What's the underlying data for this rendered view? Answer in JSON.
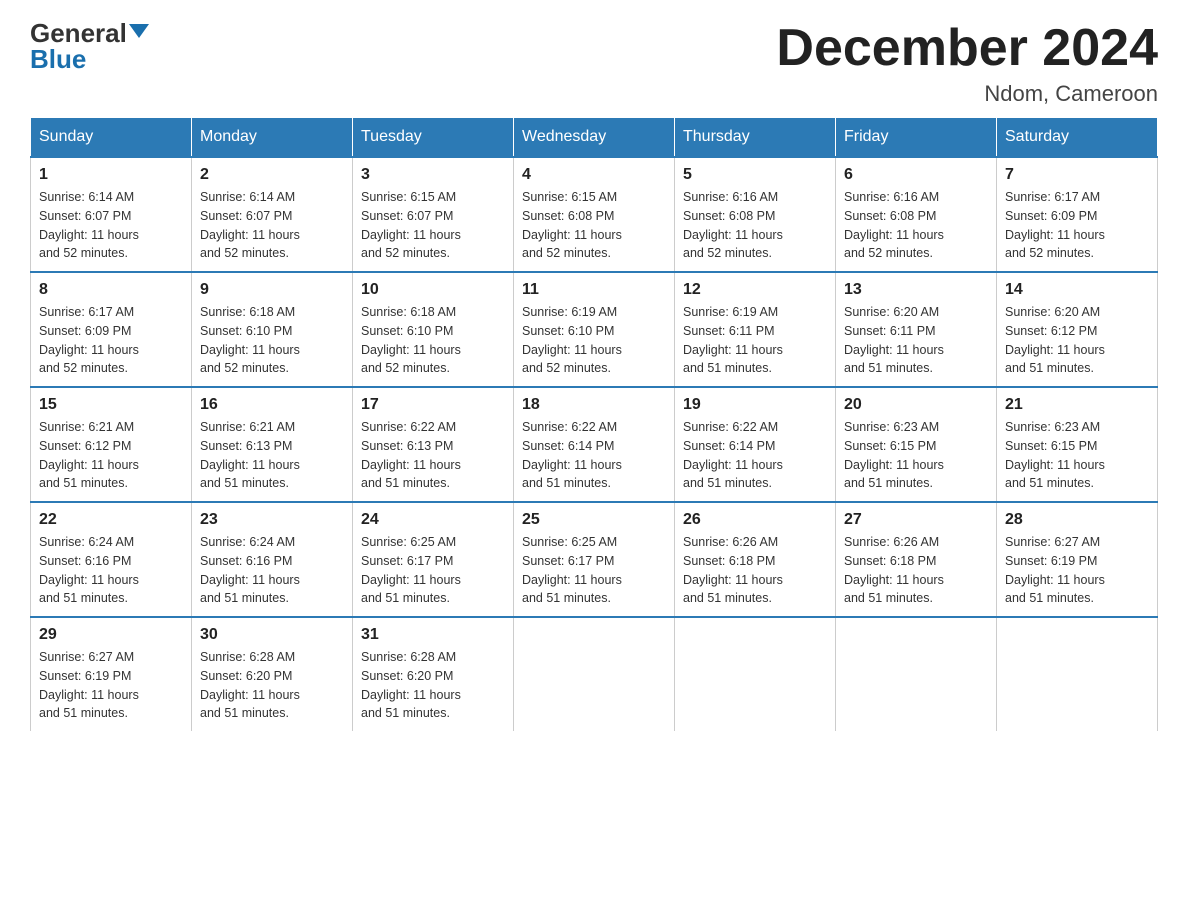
{
  "logo": {
    "general": "General",
    "blue": "Blue"
  },
  "title": "December 2024",
  "location": "Ndom, Cameroon",
  "weekdays": [
    "Sunday",
    "Monday",
    "Tuesday",
    "Wednesday",
    "Thursday",
    "Friday",
    "Saturday"
  ],
  "weeks": [
    [
      {
        "day": "1",
        "info": "Sunrise: 6:14 AM\nSunset: 6:07 PM\nDaylight: 11 hours\nand 52 minutes."
      },
      {
        "day": "2",
        "info": "Sunrise: 6:14 AM\nSunset: 6:07 PM\nDaylight: 11 hours\nand 52 minutes."
      },
      {
        "day": "3",
        "info": "Sunrise: 6:15 AM\nSunset: 6:07 PM\nDaylight: 11 hours\nand 52 minutes."
      },
      {
        "day": "4",
        "info": "Sunrise: 6:15 AM\nSunset: 6:08 PM\nDaylight: 11 hours\nand 52 minutes."
      },
      {
        "day": "5",
        "info": "Sunrise: 6:16 AM\nSunset: 6:08 PM\nDaylight: 11 hours\nand 52 minutes."
      },
      {
        "day": "6",
        "info": "Sunrise: 6:16 AM\nSunset: 6:08 PM\nDaylight: 11 hours\nand 52 minutes."
      },
      {
        "day": "7",
        "info": "Sunrise: 6:17 AM\nSunset: 6:09 PM\nDaylight: 11 hours\nand 52 minutes."
      }
    ],
    [
      {
        "day": "8",
        "info": "Sunrise: 6:17 AM\nSunset: 6:09 PM\nDaylight: 11 hours\nand 52 minutes."
      },
      {
        "day": "9",
        "info": "Sunrise: 6:18 AM\nSunset: 6:10 PM\nDaylight: 11 hours\nand 52 minutes."
      },
      {
        "day": "10",
        "info": "Sunrise: 6:18 AM\nSunset: 6:10 PM\nDaylight: 11 hours\nand 52 minutes."
      },
      {
        "day": "11",
        "info": "Sunrise: 6:19 AM\nSunset: 6:10 PM\nDaylight: 11 hours\nand 52 minutes."
      },
      {
        "day": "12",
        "info": "Sunrise: 6:19 AM\nSunset: 6:11 PM\nDaylight: 11 hours\nand 51 minutes."
      },
      {
        "day": "13",
        "info": "Sunrise: 6:20 AM\nSunset: 6:11 PM\nDaylight: 11 hours\nand 51 minutes."
      },
      {
        "day": "14",
        "info": "Sunrise: 6:20 AM\nSunset: 6:12 PM\nDaylight: 11 hours\nand 51 minutes."
      }
    ],
    [
      {
        "day": "15",
        "info": "Sunrise: 6:21 AM\nSunset: 6:12 PM\nDaylight: 11 hours\nand 51 minutes."
      },
      {
        "day": "16",
        "info": "Sunrise: 6:21 AM\nSunset: 6:13 PM\nDaylight: 11 hours\nand 51 minutes."
      },
      {
        "day": "17",
        "info": "Sunrise: 6:22 AM\nSunset: 6:13 PM\nDaylight: 11 hours\nand 51 minutes."
      },
      {
        "day": "18",
        "info": "Sunrise: 6:22 AM\nSunset: 6:14 PM\nDaylight: 11 hours\nand 51 minutes."
      },
      {
        "day": "19",
        "info": "Sunrise: 6:22 AM\nSunset: 6:14 PM\nDaylight: 11 hours\nand 51 minutes."
      },
      {
        "day": "20",
        "info": "Sunrise: 6:23 AM\nSunset: 6:15 PM\nDaylight: 11 hours\nand 51 minutes."
      },
      {
        "day": "21",
        "info": "Sunrise: 6:23 AM\nSunset: 6:15 PM\nDaylight: 11 hours\nand 51 minutes."
      }
    ],
    [
      {
        "day": "22",
        "info": "Sunrise: 6:24 AM\nSunset: 6:16 PM\nDaylight: 11 hours\nand 51 minutes."
      },
      {
        "day": "23",
        "info": "Sunrise: 6:24 AM\nSunset: 6:16 PM\nDaylight: 11 hours\nand 51 minutes."
      },
      {
        "day": "24",
        "info": "Sunrise: 6:25 AM\nSunset: 6:17 PM\nDaylight: 11 hours\nand 51 minutes."
      },
      {
        "day": "25",
        "info": "Sunrise: 6:25 AM\nSunset: 6:17 PM\nDaylight: 11 hours\nand 51 minutes."
      },
      {
        "day": "26",
        "info": "Sunrise: 6:26 AM\nSunset: 6:18 PM\nDaylight: 11 hours\nand 51 minutes."
      },
      {
        "day": "27",
        "info": "Sunrise: 6:26 AM\nSunset: 6:18 PM\nDaylight: 11 hours\nand 51 minutes."
      },
      {
        "day": "28",
        "info": "Sunrise: 6:27 AM\nSunset: 6:19 PM\nDaylight: 11 hours\nand 51 minutes."
      }
    ],
    [
      {
        "day": "29",
        "info": "Sunrise: 6:27 AM\nSunset: 6:19 PM\nDaylight: 11 hours\nand 51 minutes."
      },
      {
        "day": "30",
        "info": "Sunrise: 6:28 AM\nSunset: 6:20 PM\nDaylight: 11 hours\nand 51 minutes."
      },
      {
        "day": "31",
        "info": "Sunrise: 6:28 AM\nSunset: 6:20 PM\nDaylight: 11 hours\nand 51 minutes."
      },
      {
        "day": "",
        "info": ""
      },
      {
        "day": "",
        "info": ""
      },
      {
        "day": "",
        "info": ""
      },
      {
        "day": "",
        "info": ""
      }
    ]
  ]
}
